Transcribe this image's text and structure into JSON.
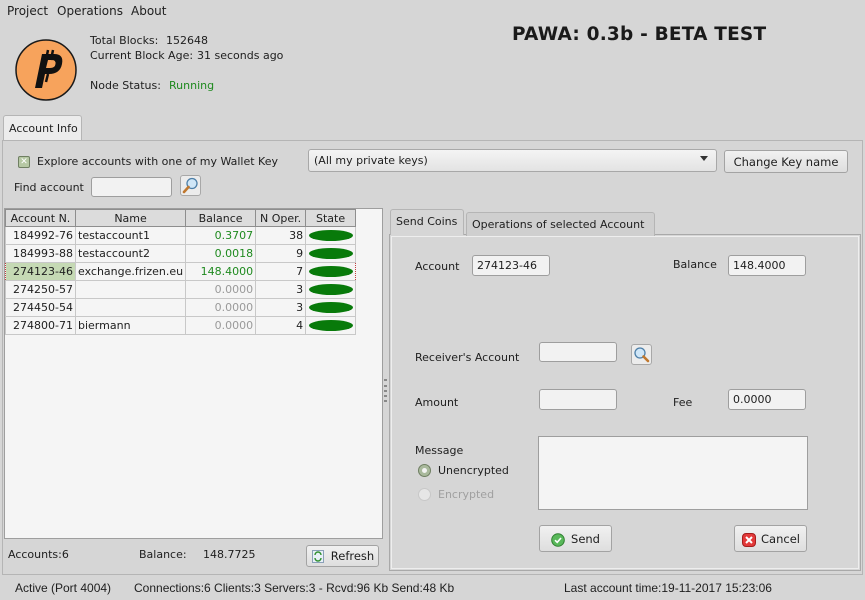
{
  "menu": [
    "Project",
    "Operations",
    "About"
  ],
  "header": {
    "logo_icon": "pascalcoin-logo-icon",
    "total_blocks_label": "Total Blocks:",
    "total_blocks_value": "152648",
    "block_age_label": "Current Block Age:",
    "block_age_value": "31 seconds ago",
    "node_status_label": "Node Status:",
    "node_status_value": "Running",
    "title": "PAWA: 0.3b - BETA TEST"
  },
  "tabs": {
    "account_info": "Account Info"
  },
  "filters": {
    "explore_checkbox_label": "Explore accounts with one of my Wallet Key",
    "explore_checked": true,
    "find_account_label": "Find account",
    "find_account_value": "",
    "key_select_value": "(All my private keys)",
    "change_key_button": "Change Key name"
  },
  "accounts_table": {
    "columns": [
      "Account N.",
      "Name",
      "Balance",
      "N Oper.",
      "State"
    ],
    "rows": [
      {
        "account": "184992-76",
        "name": "testaccount1",
        "balance": "0.3707",
        "ops": "38",
        "state": "ok",
        "positive": true
      },
      {
        "account": "184993-88",
        "name": "testaccount2",
        "balance": "0.0018",
        "ops": "9",
        "state": "ok",
        "positive": true
      },
      {
        "account": "274123-46",
        "name": "exchange.frizen.eu",
        "balance": "148.4000",
        "ops": "7",
        "state": "ok",
        "positive": true,
        "selected": true
      },
      {
        "account": "274250-57",
        "name": "",
        "balance": "0.0000",
        "ops": "3",
        "state": "ok",
        "positive": false
      },
      {
        "account": "274450-54",
        "name": "",
        "balance": "0.0000",
        "ops": "3",
        "state": "ok",
        "positive": false
      },
      {
        "account": "274800-71",
        "name": "biermann",
        "balance": "0.0000",
        "ops": "4",
        "state": "ok",
        "positive": false
      }
    ],
    "accounts_count_label": "Accounts:6",
    "total_balance_label": "Balance:",
    "total_balance_value": "148.7725",
    "refresh_button": "Refresh"
  },
  "send_panel": {
    "tabs": [
      "Send Coins",
      "Operations of selected Account"
    ],
    "active_tab": 0,
    "account_label": "Account",
    "account_value": "274123-46",
    "balance_label": "Balance",
    "balance_value": "148.4000",
    "receiver_label": "Receiver's Account",
    "receiver_value": "",
    "amount_label": "Amount",
    "amount_value": "",
    "fee_label": "Fee",
    "fee_value": "0.0000",
    "message_label": "Message",
    "message_value": "",
    "radio_unencrypted": "Unencrypted",
    "radio_encrypted": "Encrypted",
    "selected_radio": "Unencrypted",
    "send_button": "Send",
    "cancel_button": "Cancel"
  },
  "statusbar": {
    "active": "Active (Port 4004)",
    "connections": "Connections:6 Clients:3 Servers:3 - Rcvd:96 Kb Send:48 Kb",
    "last_account_time": "Last account time:19-11-2017 15:23:06"
  },
  "colors": {
    "running": "#1f8a1f",
    "positive_balance": "#1f8a1f",
    "zero_balance": "#9a9a9a",
    "state_ok": "#087a0a",
    "logo_orange": "#f7a35c"
  }
}
